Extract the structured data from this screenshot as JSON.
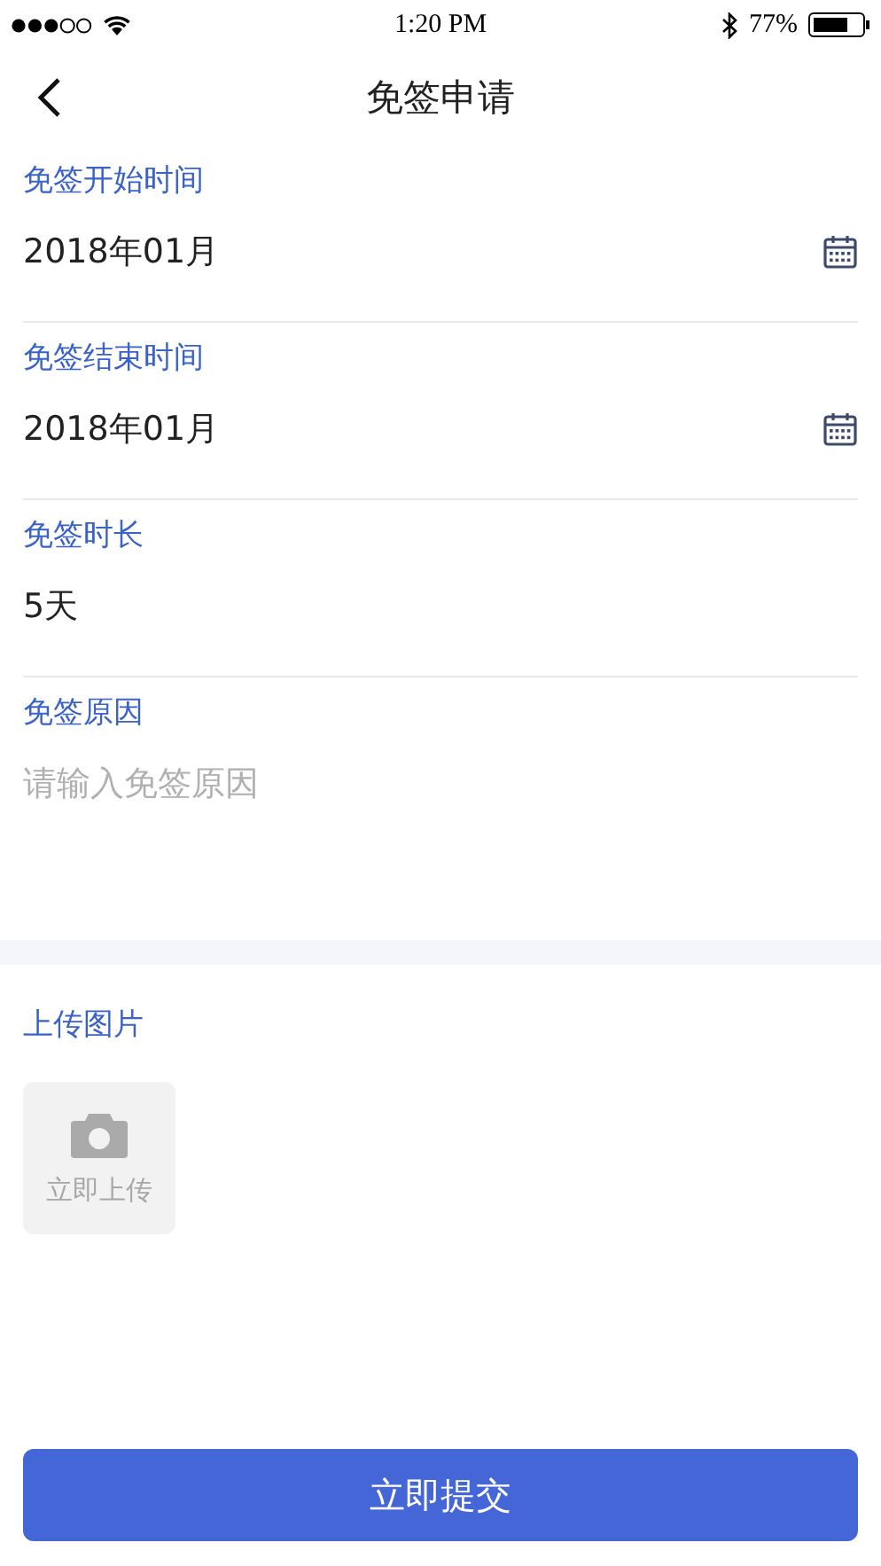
{
  "status_bar": {
    "time": "1:20 PM",
    "battery": "77%"
  },
  "nav": {
    "title": "免签申请"
  },
  "fields": [
    {
      "kind": "date",
      "label": "免签开始时间",
      "value": "2018年01月"
    },
    {
      "kind": "date",
      "label": "免签结束时间",
      "value": "2018年01月"
    },
    {
      "kind": "text",
      "label": "免签时长",
      "value": "5天"
    },
    {
      "kind": "textarea",
      "label": "免签原因",
      "placeholder": "请输入免签原因"
    }
  ],
  "upload": {
    "label": "上传图片",
    "button": "立即上传"
  },
  "submit": "立即提交"
}
